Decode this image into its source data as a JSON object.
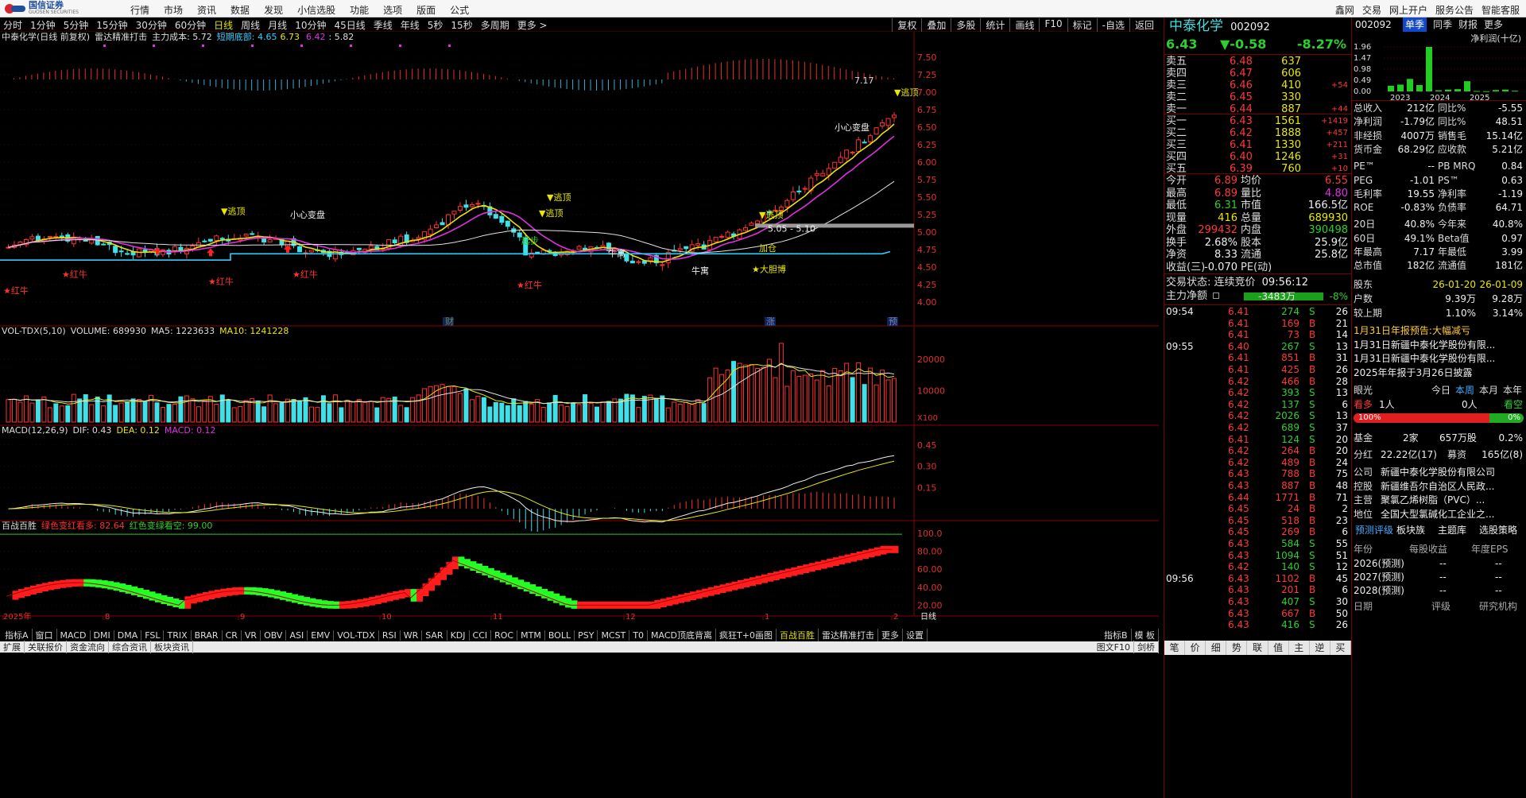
{
  "topbar": {
    "brand_name": "国信证券",
    "brand_sub": "GUOSEN SECURITIES",
    "menu": [
      "行情",
      "市场",
      "资讯",
      "数据",
      "发现",
      "小信选股",
      "功能",
      "选项",
      "版面",
      "公式"
    ],
    "right": [
      "鑫网",
      "交易",
      "网上开户",
      "服务公告",
      "智能客服"
    ]
  },
  "periods": [
    "分时",
    "1分钟",
    "5分钟",
    "15分钟",
    "30分钟",
    "60分钟",
    "日线",
    "周线",
    "月线",
    "10分钟",
    "45日线",
    "季线",
    "年线",
    "5秒",
    "15秒",
    "多周期",
    "更多 >"
  ],
  "period_active": "日线",
  "period_right": [
    "复权",
    "叠加",
    "多股",
    "统计",
    "画线",
    "F10",
    "标记",
    "-自选",
    "返回"
  ],
  "kline_header": {
    "name": "中泰化学(日线 前复权)",
    "indicator": "雷达精准打击",
    "cost_label": "主力成本: 5.72",
    "short_label": "短期底部: 4.65",
    "v1": "6.73",
    "v2": "6.42",
    "v3": "5.82"
  },
  "price_axis": [
    "7.50",
    "7.25",
    "7.00",
    "6.75",
    "6.50",
    "6.25",
    "6.00",
    "5.75",
    "5.50",
    "5.25",
    "5.00",
    "4.75",
    "4.50",
    "4.25",
    "4.00"
  ],
  "annotations": {
    "high_marker": "7.17",
    "escape1": "▼逃顶",
    "escape2": "▼逃顶",
    "escape3": "▼逃顶",
    "escape4": "▼逃顶",
    "escape5": "▼逃顶",
    "careful1": "小心变盘",
    "careful2": "小心变盘",
    "redcow": [
      "★红牛",
      "★红牛",
      "★红牛",
      "★红牛",
      "★红牛"
    ],
    "bull": "牛寓",
    "bull2": "牛寓",
    "bold": "★大胆博",
    "add": "加仓",
    "start": "起步",
    "range": "5.05 - 5.10",
    "finance": "财",
    "rise": "涨",
    "pre": "预"
  },
  "volume_header": {
    "name": "VOL-TDX(5,10)",
    "volume": "VOLUME: 689930",
    "ma5": "MA5: 1223633",
    "ma10": "MA10: 1241228"
  },
  "volume_axis": [
    "20000",
    "10000"
  ],
  "volume_unit": "X100",
  "macd_header": {
    "name": "MACD(12,26,9)",
    "dif": "DIF: 0.43",
    "dea": "DEA: 0.12",
    "macd": "MACD: 0.12"
  },
  "macd_axis": [
    "0.45",
    "0.30",
    "0.15"
  ],
  "bz_header": {
    "name": "百战百胜",
    "g": "绿色变红看多: 82.64",
    "r": "红色变绿看空: 99.00"
  },
  "bz_axis": [
    "100.0",
    "80.00",
    "60.00",
    "40.00",
    "20.00"
  ],
  "date_axis": [
    "2025年",
    "8",
    "9",
    "10",
    "11",
    "12",
    "1",
    "2",
    "日线"
  ],
  "indicator_tabs": [
    "指标A",
    "窗口",
    "MACD",
    "DMI",
    "DMA",
    "FSL",
    "TRIX",
    "BRAR",
    "CR",
    "VR",
    "OBV",
    "ASI",
    "EMV",
    "VOL-TDX",
    "RSI",
    "WR",
    "SAR",
    "KDJ",
    "CCI",
    "ROC",
    "MTM",
    "BOLL",
    "PSY",
    "MCST",
    "T0",
    "MACD顶底背离",
    "疯狂T+0画图",
    "百战百胜",
    "雷达精准打击",
    "更多",
    "设置"
  ],
  "indicator_active": "百战百胜",
  "indicator_right": [
    "指标B",
    "模 板"
  ],
  "bottom_tabs": [
    "扩展",
    "关联报价",
    "资金流向",
    "综合资讯",
    "板块资讯"
  ],
  "bottom_right": [
    "图文F10",
    "剑桥"
  ],
  "stock": {
    "name": "中泰化学",
    "code": "002092",
    "price": "6.43",
    "change": "▼-0.58",
    "pct": "-8.27%"
  },
  "asks": [
    {
      "l": "卖五",
      "p": "6.48",
      "v": "637",
      "c": ""
    },
    {
      "l": "卖四",
      "p": "6.47",
      "v": "606",
      "c": ""
    },
    {
      "l": "卖三",
      "p": "6.46",
      "v": "410",
      "c": "+54"
    },
    {
      "l": "卖二",
      "p": "6.45",
      "v": "330",
      "c": ""
    },
    {
      "l": "卖一",
      "p": "6.44",
      "v": "887",
      "c": "+44"
    }
  ],
  "bids": [
    {
      "l": "买一",
      "p": "6.43",
      "v": "1561",
      "c": "+1419"
    },
    {
      "l": "买二",
      "p": "6.42",
      "v": "1888",
      "c": "+457"
    },
    {
      "l": "买三",
      "p": "6.41",
      "v": "1330",
      "c": "+211"
    },
    {
      "l": "买四",
      "p": "6.40",
      "v": "1246",
      "c": "+31"
    },
    {
      "l": "买五",
      "p": "6.39",
      "v": "760",
      "c": "+10"
    }
  ],
  "stats": [
    {
      "a": "今开",
      "av": "6.89",
      "b": "均价",
      "bv": "6.55"
    },
    {
      "a": "最高",
      "av": "6.89",
      "b": "量比",
      "bv": "4.80"
    },
    {
      "a": "最低",
      "av": "6.31",
      "b": "市值",
      "bv": "166.5亿"
    },
    {
      "a": "现量",
      "av": "416",
      "b": "总量",
      "bv": "689930"
    },
    {
      "a": "外盘",
      "av": "299432",
      "b": "内盘",
      "bv": "390498"
    },
    {
      "a": "换手",
      "av": "2.68%",
      "b": "股本",
      "bv": "25.9亿"
    },
    {
      "a": "净资",
      "av": "8.33",
      "b": "流通",
      "bv": "25.8亿"
    },
    {
      "a": "收益(三)",
      "av": "-0.070",
      "b": "PE(动)",
      "bv": ""
    }
  ],
  "trade_status": {
    "label": "交易状态: 连续竞价",
    "time": "09:56:12"
  },
  "main_flow": {
    "label": "主力净额",
    "value": "-3483万",
    "pct": "-8%"
  },
  "ticks": [
    {
      "t": "09:54",
      "p": "6.41",
      "v": "274",
      "s": "S",
      "n": "26"
    },
    {
      "t": "",
      "p": "6.41",
      "v": "169",
      "s": "B",
      "n": "21"
    },
    {
      "t": "",
      "p": "6.41",
      "v": "73",
      "s": "B",
      "n": "14"
    },
    {
      "t": "09:55",
      "p": "6.40",
      "v": "267",
      "s": "S",
      "n": "13"
    },
    {
      "t": "",
      "p": "6.41",
      "v": "851",
      "s": "B",
      "n": "31"
    },
    {
      "t": "",
      "p": "6.41",
      "v": "425",
      "s": "B",
      "n": "26"
    },
    {
      "t": "",
      "p": "6.42",
      "v": "466",
      "s": "B",
      "n": "28"
    },
    {
      "t": "",
      "p": "6.42",
      "v": "393",
      "s": "S",
      "n": "13"
    },
    {
      "t": "",
      "p": "6.42",
      "v": "137",
      "s": "S",
      "n": "6"
    },
    {
      "t": "",
      "p": "6.42",
      "v": "2026",
      "s": "S",
      "n": "13"
    },
    {
      "t": "",
      "p": "6.42",
      "v": "689",
      "s": "S",
      "n": "37"
    },
    {
      "t": "",
      "p": "6.41",
      "v": "124",
      "s": "S",
      "n": "20"
    },
    {
      "t": "",
      "p": "6.42",
      "v": "264",
      "s": "B",
      "n": "20"
    },
    {
      "t": "",
      "p": "6.42",
      "v": "489",
      "s": "B",
      "n": "24"
    },
    {
      "t": "",
      "p": "6.43",
      "v": "788",
      "s": "B",
      "n": "75"
    },
    {
      "t": "",
      "p": "6.43",
      "v": "887",
      "s": "B",
      "n": "48"
    },
    {
      "t": "",
      "p": "6.44",
      "v": "1771",
      "s": "B",
      "n": "71"
    },
    {
      "t": "",
      "p": "6.45",
      "v": "24",
      "s": "B",
      "n": "2"
    },
    {
      "t": "",
      "p": "6.45",
      "v": "518",
      "s": "B",
      "n": "23"
    },
    {
      "t": "",
      "p": "6.45",
      "v": "269",
      "s": "B",
      "n": "6"
    },
    {
      "t": "",
      "p": "6.43",
      "v": "584",
      "s": "S",
      "n": "55"
    },
    {
      "t": "",
      "p": "6.43",
      "v": "1094",
      "s": "S",
      "n": "51"
    },
    {
      "t": "",
      "p": "6.42",
      "v": "140",
      "s": "S",
      "n": "12"
    },
    {
      "t": "09:56",
      "p": "6.43",
      "v": "1102",
      "s": "B",
      "n": "45"
    },
    {
      "t": "",
      "p": "6.43",
      "v": "201",
      "s": "B",
      "n": "6"
    },
    {
      "t": "",
      "p": "6.43",
      "v": "407",
      "s": "S",
      "n": "30"
    },
    {
      "t": "",
      "p": "6.43",
      "v": "667",
      "s": "B",
      "n": "50"
    },
    {
      "t": "",
      "p": "6.43",
      "v": "416",
      "s": "S",
      "n": "26"
    }
  ],
  "quote_bottom": [
    "笔",
    "价",
    "细",
    "势",
    "联",
    "值",
    "主",
    "逆",
    "买"
  ],
  "fin": {
    "code": "002092",
    "tabs": [
      "单季",
      "同季",
      "财报",
      "更多"
    ],
    "metric": "净利润(十亿)",
    "yaxis": [
      "1.96",
      "1.47",
      "0.98",
      "0.49",
      "0.00"
    ],
    "years": [
      "2023",
      "2024",
      "2025"
    ],
    "bars": [
      0.25,
      0.3,
      0.55,
      0.28,
      1.96,
      0.05,
      0.08,
      0.1,
      0.45,
      0.02,
      0.01,
      0.06,
      0.08,
      0.03
    ],
    "rows": [
      {
        "a": "总收入",
        "av": "212亿",
        "b": "同比%",
        "bv": "-5.55"
      },
      {
        "a": "净利润",
        "av": "-1.79亿",
        "b": "同比%",
        "bv": "48.51"
      },
      {
        "a": "非经损",
        "av": "4007万",
        "b": "销售毛",
        "bv": "15.14亿"
      },
      {
        "a": "货币金",
        "av": "68.29亿",
        "b": "应收款",
        "bv": "5.21亿"
      },
      {
        "a": "PE™",
        "av": "--",
        "b": "PB MRQ",
        "bv": "0.84"
      },
      {
        "a": "PEG",
        "av": "-1.01",
        "b": "PS™",
        "bv": "0.63"
      },
      {
        "a": "毛利率",
        "av": "19.55",
        "b": "净利率",
        "bv": "-1.19"
      },
      {
        "a": "ROE",
        "av": "-0.83%",
        "b": "负债率",
        "bv": "64.71"
      },
      {
        "a": "20日",
        "av": "40.8%",
        "b": "今年来",
        "bv": "40.8%"
      },
      {
        "a": "60日",
        "av": "49.1%",
        "b": "Beta值",
        "bv": "0.97"
      },
      {
        "a": "年最高",
        "av": "7.17",
        "b": "年最低",
        "bv": "3.99"
      },
      {
        "a": "总市值",
        "av": "182亿",
        "b": "流通值",
        "bv": "181亿"
      }
    ],
    "holders": {
      "h": [
        "股东",
        "26-01-20",
        "26-01-09"
      ],
      "r1": [
        "户数",
        "9.39万",
        "9.28万"
      ],
      "r2": [
        "较上期",
        "1.10%",
        "3.14%"
      ]
    },
    "news": [
      "1月31日年报预告:大幅减亏",
      "1月31日新疆中泰化学股份有限...",
      "1月31日新疆中泰化学股份有限...",
      "2025年年报于3月26日披露"
    ],
    "view": {
      "label": "眼光",
      "tabs": [
        "今日",
        "本周",
        "本月",
        "本年"
      ],
      "bull": "看多",
      "bull_n": "1人",
      "bear_n": "0人",
      "bear": "看空",
      "bull_pct": "100%",
      "bear_pct": "0%"
    },
    "fund": {
      "label": "基金",
      "n": "2家",
      "amt": "657万股",
      "pct": "0.2%"
    },
    "div": {
      "label": "分红",
      "v": "22.22亿(17)",
      "b": "募资",
      "bv": "165亿(8)"
    },
    "company": [
      {
        "k": "公司",
        "v": "新疆中泰化学股份有限公司"
      },
      {
        "k": "控股",
        "v": "新疆维吾尔自治区人民政..."
      },
      {
        "k": "主营",
        "v": "聚氯乙烯树脂（PVC）..."
      },
      {
        "k": "地位",
        "v": "全国大型氯碱化工企业之..."
      }
    ],
    "forecast_tabs": [
      "预测评级",
      "板块族",
      "主题库",
      "选股策略"
    ],
    "forecast_head": [
      "年份",
      "每股收益",
      "年度EPS"
    ],
    "forecast_rows": [
      [
        "2026(预测)",
        "--",
        "--"
      ],
      [
        "2027(预测)",
        "--",
        "--"
      ],
      [
        "2028(预测)",
        "--",
        "--"
      ]
    ],
    "rating_head": [
      "日期",
      "评级",
      "研究机构"
    ]
  }
}
